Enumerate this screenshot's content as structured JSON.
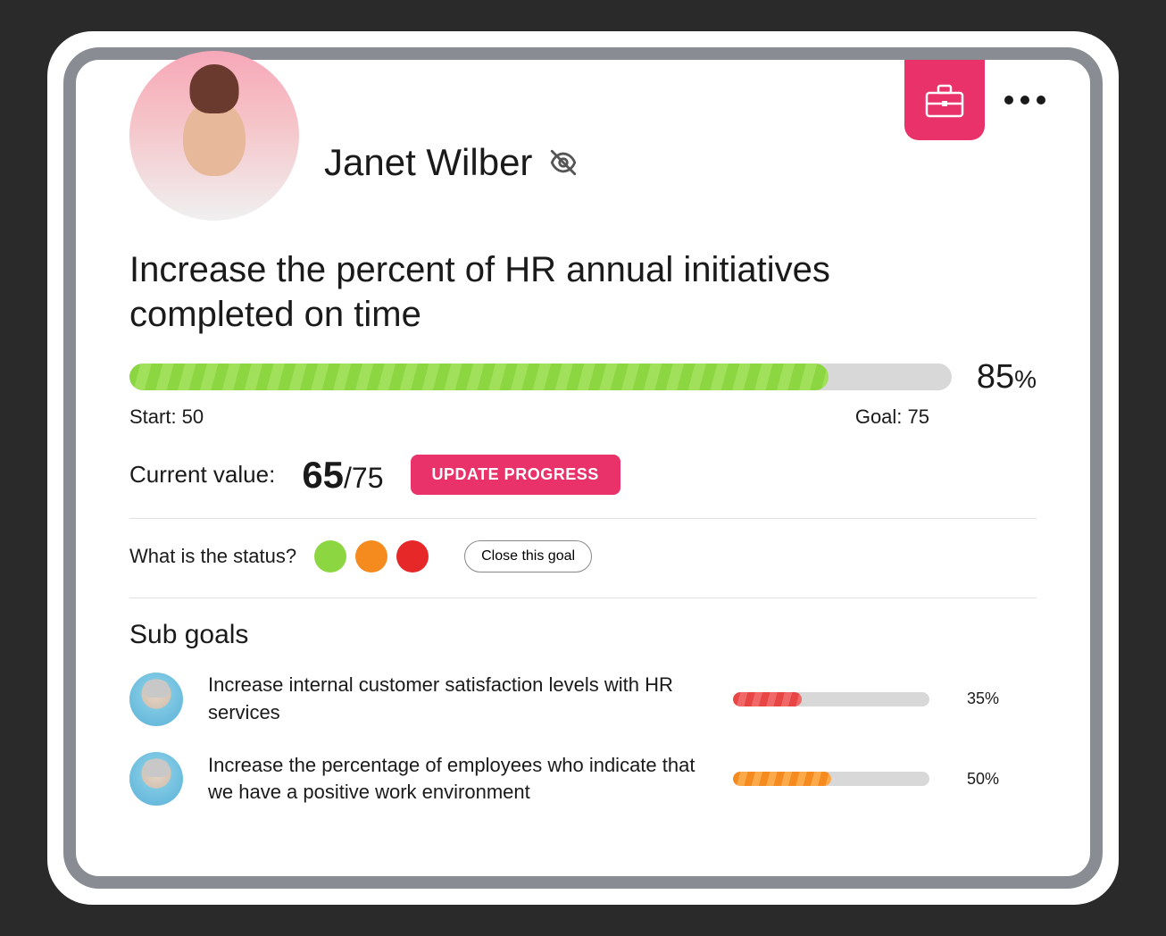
{
  "user": {
    "name": "Janet Wilber"
  },
  "goal": {
    "title": "Increase the percent of HR annual initiatives completed on time",
    "start_label": "Start: 50",
    "goal_label": "Goal: 75",
    "percent_display": "85",
    "percent_suffix": "%",
    "progress_percent": 85,
    "current_label": "Current value:",
    "current_value": "65",
    "current_denom": "/75"
  },
  "actions": {
    "update_progress": "UPDATE PROGRESS",
    "close_goal": "Close this goal"
  },
  "status": {
    "label": "What is the status?",
    "options": [
      "green",
      "orange",
      "red"
    ]
  },
  "subgoals": {
    "heading": "Sub goals",
    "items": [
      {
        "title": "Increase internal customer satisfaction levels with HR services",
        "percent": 35,
        "percent_display": "35%",
        "color": "red"
      },
      {
        "title": "Increase the percentage of employees who indicate that we have a positive work environment",
        "percent": 50,
        "percent_display": "50%",
        "color": "orange"
      }
    ]
  }
}
